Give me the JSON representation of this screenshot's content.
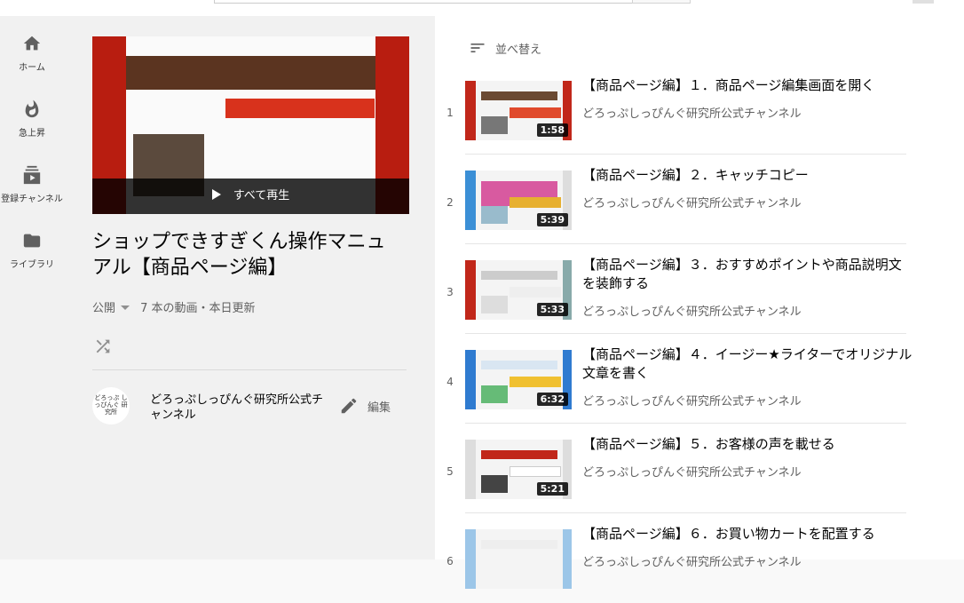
{
  "sidebar": {
    "items": [
      {
        "label": "ホーム",
        "icon": "home-icon"
      },
      {
        "label": "急上昇",
        "icon": "flame-icon"
      },
      {
        "label": "登録チャンネル",
        "icon": "subscriptions-icon"
      },
      {
        "label": "ライブラリ",
        "icon": "folder-icon"
      }
    ]
  },
  "playlist": {
    "play_all_label": "すべて再生",
    "title": "ショップできすぎくん操作マニュアル【商品ページ編】",
    "privacy": "公開",
    "stats": "7 本の動画・本日更新",
    "channel_name": "どろっぷしっぴんぐ研究所公式チャンネル",
    "avatar_text": "どろっぷ しっぴんぐ 研究所",
    "edit_label": "編集"
  },
  "list": {
    "sort_label": "並べ替え",
    "videos": [
      {
        "index": "1",
        "title": "【商品ページ編】１．商品ページ編集画面を開く",
        "channel": "どろっぷしっぴんぐ研究所公式チャンネル",
        "duration": "1:58"
      },
      {
        "index": "2",
        "title": "【商品ページ編】２．キャッチコピー",
        "channel": "どろっぷしっぴんぐ研究所公式チャンネル",
        "duration": "5:39"
      },
      {
        "index": "3",
        "title": "【商品ページ編】３．おすすめポイントや商品説明文を装飾する",
        "channel": "どろっぷしっぴんぐ研究所公式チャンネル",
        "duration": "5:33"
      },
      {
        "index": "4",
        "title": "【商品ページ編】４．イージー★ライターでオリジナル文章を書く",
        "channel": "どろっぷしっぴんぐ研究所公式チャンネル",
        "duration": "6:32"
      },
      {
        "index": "5",
        "title": "【商品ページ編】５．お客様の声を載せる",
        "channel": "どろっぷしっぴんぐ研究所公式チャンネル",
        "duration": "5:21"
      },
      {
        "index": "6",
        "title": "【商品ページ編】６．お買い物カートを配置する",
        "channel": "どろっぷしっぴんぐ研究所公式チャンネル",
        "duration": ""
      }
    ]
  }
}
